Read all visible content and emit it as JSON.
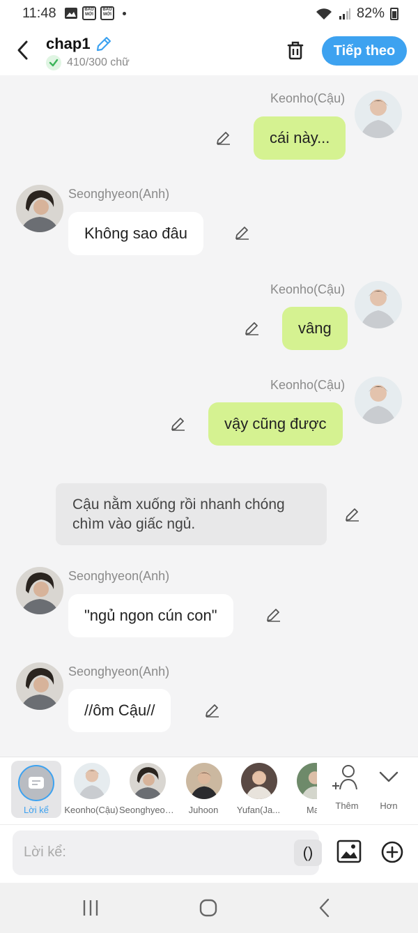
{
  "status": {
    "time": "11:48",
    "notif_label_1": "BÁO MỚI",
    "notif_label_2": "BÁO MỚI",
    "battery": "82%"
  },
  "header": {
    "title": "chap1",
    "word_count": "410/300 chữ",
    "next_label": "Tiếp theo"
  },
  "messages": [
    {
      "side": "right",
      "sender": "Keonho(Cậu)",
      "text": "cái này..."
    },
    {
      "side": "left",
      "sender": "Seonghyeon(Anh)",
      "text": "Không sao đâu"
    },
    {
      "side": "right",
      "sender": "Keonho(Cậu)",
      "text": "vâng"
    },
    {
      "side": "right",
      "sender": "Keonho(Cậu)",
      "text": "vậy cũng được"
    },
    {
      "side": "narration",
      "text": "Cậu nằm xuống rồi nhanh chóng chìm vào giấc ngủ."
    },
    {
      "side": "left",
      "sender": "Seonghyeon(Anh)",
      "text": "\"ngủ ngon cún con\""
    },
    {
      "side": "left",
      "sender": "Seonghyeon(Anh)",
      "text": "//ôm Cậu//"
    }
  ],
  "characters": {
    "narrator_label": "Lời kể",
    "items": [
      {
        "label": "Keonho(Cậu)"
      },
      {
        "label": "Seonghyeon(Anh)"
      },
      {
        "label": "Juhoon"
      },
      {
        "label": "Yufan(Ja..."
      },
      {
        "label": "Ma"
      }
    ],
    "add_label": "Thêm",
    "more_label": "Hơn"
  },
  "composer": {
    "placeholder": "Lời kể:",
    "paren_label": "()"
  },
  "colors": {
    "accent": "#3da2f0",
    "right_bubble": "#d5f291",
    "left_bubble": "#ffffff",
    "narration_bg": "#e8e8e9"
  }
}
